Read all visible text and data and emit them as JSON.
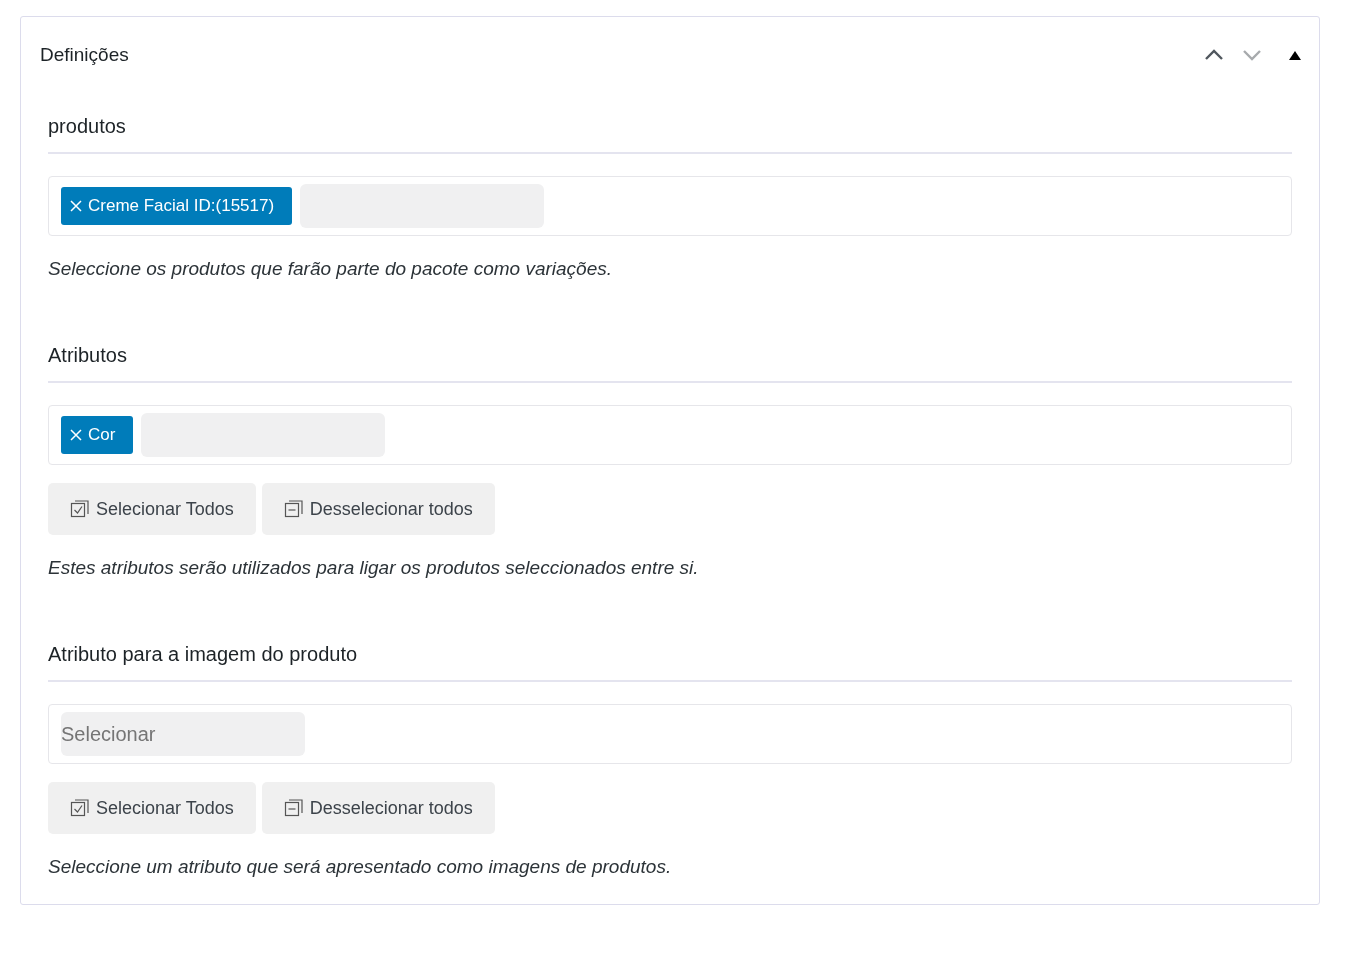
{
  "panel": {
    "title": "Definições",
    "controls": [
      {
        "kind": "up",
        "disabled": false
      },
      {
        "kind": "down",
        "disabled": true
      },
      {
        "kind": "toggle"
      }
    ]
  },
  "sections": [
    {
      "heading": "produtos",
      "tags": [
        {
          "label": "Creme Facial ID:(15517)"
        }
      ],
      "help": "Seleccione os produtos que farão parte do pacote como variações."
    },
    {
      "heading": "Atributos",
      "tags": [
        {
          "label": "Cor"
        }
      ],
      "buttons": [
        {
          "kind": "select-all",
          "label": "Selecionar Todos"
        },
        {
          "kind": "deselect-all",
          "label": "Desselecionar todos"
        }
      ],
      "help": "Estes atributos serão utilizados para ligar os produtos seleccionados entre si."
    },
    {
      "heading": "Atributo para a imagem do produto",
      "placeholder": "Selecionar",
      "buttons": [
        {
          "kind": "select-all",
          "label": "Selecionar Todos"
        },
        {
          "kind": "deselect-all",
          "label": "Desselecionar todos"
        }
      ],
      "help": "Seleccione um atributo que será apresentado como imagens de produtos."
    }
  ]
}
